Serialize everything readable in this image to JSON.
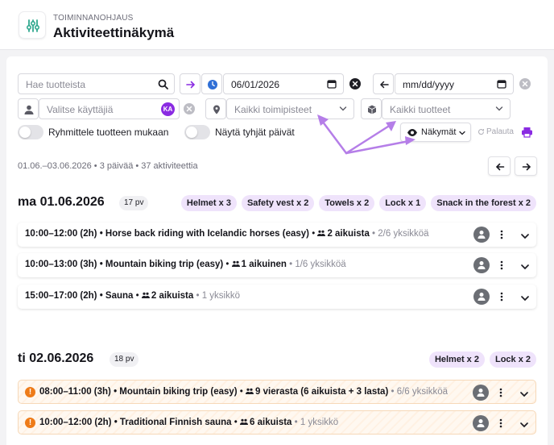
{
  "header": {
    "subtitle": "TOIMINNANOHJAUS",
    "title": "Aktiviteettinäkymä",
    "icon": "sliders-icon",
    "accent": "#2fa88e"
  },
  "filters": {
    "product_search": {
      "placeholder": "Hae tuotteista",
      "value": ""
    },
    "start_date": {
      "value": "06/01/2026"
    },
    "end_date": {
      "value": "mm/dd/yyyy"
    },
    "user_select": {
      "placeholder": "Valitse käyttäjiä",
      "user_badge": "KA"
    },
    "location_select": {
      "value": "Kaikki toimipisteet"
    },
    "product_select": {
      "value": "Kaikki tuotteet"
    },
    "group_by_product": {
      "label": "Ryhmittele tuotteen mukaan",
      "on": false
    },
    "show_empty_days": {
      "label": "Näytä tyhjät päivät",
      "on": false
    },
    "views_button": "Näkymät",
    "reset_button": "Palauta"
  },
  "summary": "01.06.–03.06.2026 • 3 päivää • 37 aktiviteettia",
  "days": [
    {
      "title": "ma 01.06.2026",
      "count": "17 pv",
      "chips": [
        "Helmet x 3",
        "Safety vest x 2",
        "Towels x 2",
        "Lock x 1",
        "Snack in the forest x 2"
      ],
      "activities": [
        {
          "time": "10:00–12:00 (2h)",
          "name": "Horse back riding with Icelandic horses (easy)",
          "people": "2 aikuista",
          "units": "2/6 yksikköä"
        },
        {
          "time": "10:00–13:00 (3h)",
          "name": "Mountain biking trip (easy)",
          "people": "1 aikuinen",
          "units": "1/6 yksikköä"
        },
        {
          "time": "15:00–17:00 (2h)",
          "name": "Sauna",
          "people": "2 aikuista",
          "units": "1 yksikkö"
        }
      ]
    },
    {
      "title": "ti 02.06.2026",
      "count": "18 pv",
      "chips": [
        "Helmet x 2",
        "Lock x 2"
      ],
      "activities": [
        {
          "time": "08:00–11:00 (3h)",
          "name": "Mountain biking trip (easy)",
          "people": "9 vierasta (6 aikuista + 3 lasta)",
          "units": "6/6 yksikköä",
          "warning": true
        },
        {
          "time": "10:00–12:00 (2h)",
          "name": "Traditional Finnish sauna",
          "people": "6 aikuista",
          "units": "1 yksikkö",
          "warning": true
        }
      ]
    }
  ],
  "colors": {
    "brand_purple": "#8a2be2",
    "chip_bg": "#efe3fb",
    "warning": "#ee7b18",
    "annotation_arrow": "#b57ee8"
  }
}
